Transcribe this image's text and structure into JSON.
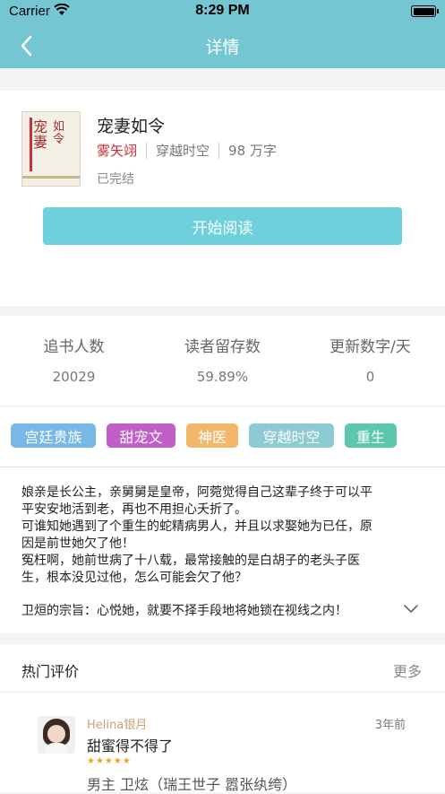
{
  "status_bar": {
    "carrier": "Carrier",
    "time": "8:29 PM"
  },
  "nav": {
    "title": "详情"
  },
  "book": {
    "title": "宠妻如令",
    "author": "雾矢翊",
    "genre": "穿越时空",
    "word_count": "98 万字",
    "status": "已完结",
    "read_button": "开始阅读"
  },
  "stats": [
    {
      "label": "追书人数",
      "value": "20029"
    },
    {
      "label": "读者留存数",
      "value": "59.89%"
    },
    {
      "label": "更新数字/天",
      "value": "0"
    }
  ],
  "tags": [
    {
      "label": "宫廷贵族",
      "color": "#78b8e6"
    },
    {
      "label": "甜宠文",
      "color": "#c25ec7"
    },
    {
      "label": "神医",
      "color": "#f4b66b"
    },
    {
      "label": "穿越时空",
      "color": "#8ccbd3"
    },
    {
      "label": "重生",
      "color": "#5cc7ad"
    }
  ],
  "description": {
    "lines": [
      "娘亲是长公主，亲舅舅是皇帝，阿菀觉得自己这辈子终于可以平",
      "平安安地活到老，再也不用担心夭折了。",
      "可谁知她遇到了个重生的蛇精病男人，并且以求娶她为已任，原",
      "因是前世她欠了他！",
      "冤枉啊，她前世病了十八载，最常接触的是白胡子的老头子医",
      "生，根本没见过他，怎么可能会欠了他？"
    ],
    "quote": "卫烜的宗旨：心悦她，就要不择手段地将她锁在视线之内！"
  },
  "reviews": {
    "title": "热门评价",
    "more": "更多",
    "items": [
      {
        "user": "Helina银月",
        "time": "3年前",
        "text": "甜蜜得不得了",
        "stars": "★★★★★",
        "subtext": "男主 卫炫（瑞王世子 嚣张纨绔）"
      }
    ]
  }
}
